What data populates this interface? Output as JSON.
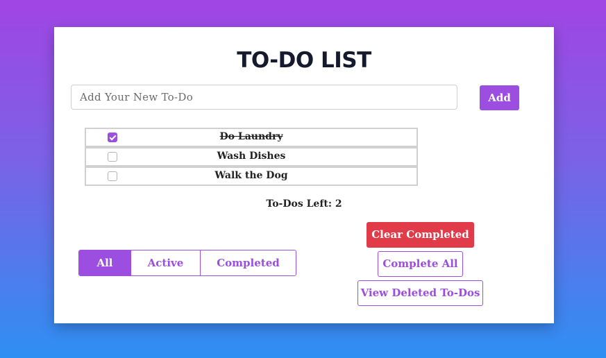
{
  "title": "TO-DO LIST",
  "new_todo": {
    "placeholder": "Add Your New To-Do",
    "value": ""
  },
  "add_label": "Add",
  "todos": [
    {
      "text": "Do Laundry",
      "completed": true
    },
    {
      "text": "Wash Dishes",
      "completed": false
    },
    {
      "text": "Walk the Dog",
      "completed": false
    }
  ],
  "todos_left": "To-Dos Left: 2",
  "filters": [
    {
      "label": "All",
      "active": true
    },
    {
      "label": "Active",
      "active": false
    },
    {
      "label": "Completed",
      "active": false
    }
  ],
  "actions": {
    "clear_completed": "Clear Completed",
    "complete_all": "Complete All",
    "view_deleted": "View Deleted To-Dos"
  },
  "colors": {
    "accent": "#9b4ee0",
    "danger": "#e13a48",
    "bg_top": "#a145e4",
    "bg_bottom": "#2e8ff2"
  }
}
